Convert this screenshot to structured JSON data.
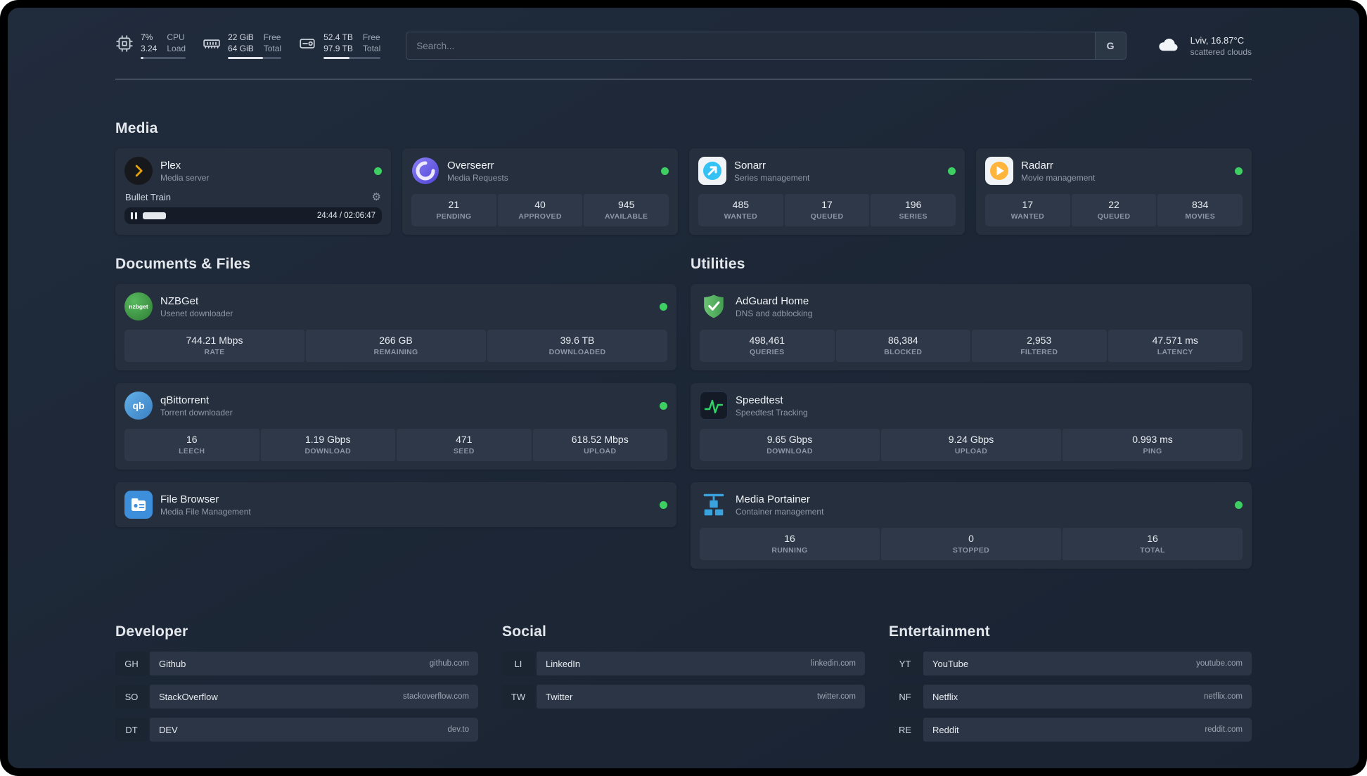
{
  "topbar": {
    "cpu": {
      "value": "7%",
      "secondary": "3.24",
      "label_primary": "CPU",
      "label_secondary": "Load",
      "progress_pct": 7
    },
    "memory": {
      "value": "22 GiB",
      "secondary": "64 GiB",
      "label_primary": "Free",
      "label_secondary": "Total",
      "progress_pct": 66
    },
    "disk": {
      "value": "52.4 TB",
      "secondary": "97.9 TB",
      "label_primary": "Free",
      "label_secondary": "Total",
      "progress_pct": 46
    },
    "search": {
      "placeholder": "Search...",
      "engine_label": "G"
    },
    "weather": {
      "location": "Lviv, 16.87°C",
      "condition": "scattered clouds"
    }
  },
  "media": {
    "title": "Media",
    "plex": {
      "name": "Plex",
      "desc": "Media server",
      "now_playing": {
        "title": "Bullet Train",
        "time": "24:44 / 02:06:47",
        "progress_pct": 14
      }
    },
    "overseerr": {
      "name": "Overseerr",
      "desc": "Media Requests",
      "stats": [
        {
          "value": "21",
          "label": "PENDING"
        },
        {
          "value": "40",
          "label": "APPROVED"
        },
        {
          "value": "945",
          "label": "AVAILABLE"
        }
      ]
    },
    "sonarr": {
      "name": "Sonarr",
      "desc": "Series management",
      "stats": [
        {
          "value": "485",
          "label": "WANTED"
        },
        {
          "value": "17",
          "label": "QUEUED"
        },
        {
          "value": "196",
          "label": "SERIES"
        }
      ]
    },
    "radarr": {
      "name": "Radarr",
      "desc": "Movie management",
      "stats": [
        {
          "value": "17",
          "label": "WANTED"
        },
        {
          "value": "22",
          "label": "QUEUED"
        },
        {
          "value": "834",
          "label": "MOVIES"
        }
      ]
    }
  },
  "documents": {
    "title": "Documents & Files",
    "nzbget": {
      "name": "NZBGet",
      "desc": "Usenet downloader",
      "icon_text": "nzbget",
      "stats": [
        {
          "value": "744.21 Mbps",
          "label": "RATE"
        },
        {
          "value": "266 GB",
          "label": "REMAINING"
        },
        {
          "value": "39.6 TB",
          "label": "DOWNLOADED"
        }
      ]
    },
    "qbittorrent": {
      "name": "qBittorrent",
      "desc": "Torrent downloader",
      "icon_text": "qb",
      "stats": [
        {
          "value": "16",
          "label": "LEECH"
        },
        {
          "value": "1.19 Gbps",
          "label": "DOWNLOAD"
        },
        {
          "value": "471",
          "label": "SEED"
        },
        {
          "value": "618.52 Mbps",
          "label": "UPLOAD"
        }
      ]
    },
    "filebrowser": {
      "name": "File Browser",
      "desc": "Media File Management"
    }
  },
  "utilities": {
    "title": "Utilities",
    "adguard": {
      "name": "AdGuard Home",
      "desc": "DNS and adblocking",
      "stats": [
        {
          "value": "498,461",
          "label": "QUERIES"
        },
        {
          "value": "86,384",
          "label": "BLOCKED"
        },
        {
          "value": "2,953",
          "label": "FILTERED"
        },
        {
          "value": "47.571 ms",
          "label": "LATENCY"
        }
      ]
    },
    "speedtest": {
      "name": "Speedtest",
      "desc": "Speedtest Tracking",
      "stats": [
        {
          "value": "9.65 Gbps",
          "label": "DOWNLOAD"
        },
        {
          "value": "9.24 Gbps",
          "label": "UPLOAD"
        },
        {
          "value": "0.993 ms",
          "label": "PING"
        }
      ]
    },
    "portainer": {
      "name": "Media Portainer",
      "desc": "Container management",
      "stats": [
        {
          "value": "16",
          "label": "RUNNING"
        },
        {
          "value": "0",
          "label": "STOPPED"
        },
        {
          "value": "16",
          "label": "TOTAL"
        }
      ]
    }
  },
  "bookmarks": {
    "groups": [
      {
        "title": "Developer",
        "items": [
          {
            "abbr": "GH",
            "name": "Github",
            "domain": "github.com"
          },
          {
            "abbr": "SO",
            "name": "StackOverflow",
            "domain": "stackoverflow.com"
          },
          {
            "abbr": "DT",
            "name": "DEV",
            "domain": "dev.to"
          }
        ]
      },
      {
        "title": "Social",
        "items": [
          {
            "abbr": "LI",
            "name": "LinkedIn",
            "domain": "linkedin.com"
          },
          {
            "abbr": "TW",
            "name": "Twitter",
            "domain": "twitter.com"
          }
        ]
      },
      {
        "title": "Entertainment",
        "items": [
          {
            "abbr": "YT",
            "name": "YouTube",
            "domain": "youtube.com"
          },
          {
            "abbr": "NF",
            "name": "Netflix",
            "domain": "netflix.com"
          },
          {
            "abbr": "RE",
            "name": "Reddit",
            "domain": "reddit.com"
          }
        ]
      }
    ]
  },
  "colors": {
    "status_online": "#3ecf63"
  }
}
